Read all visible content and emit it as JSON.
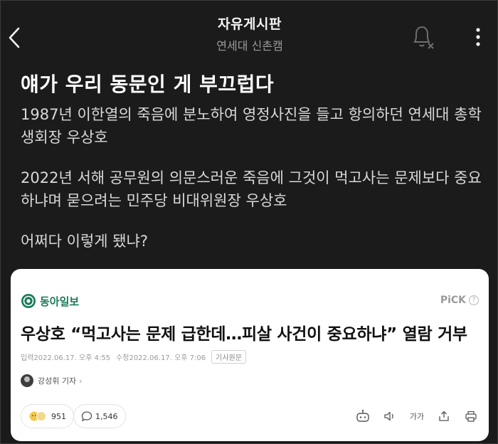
{
  "header": {
    "title": "자유게시판",
    "subtitle": "연세대 신촌캠"
  },
  "post": {
    "title": "얘가 우리 동문인 게 부끄럽다",
    "paragraphs": [
      "1987년 이한열의 죽음에 분노하여 영정사진을 들고 항의하던 연세대 총학생회장 우상호",
      "2022년 서해 공무원의 의문스러운 죽음에 그것이 먹고사는 문제보다 중요하냐며 묻으려는 민주당 비대위원장 우상호",
      "어쩌다 이렇게 됐냐?"
    ]
  },
  "article": {
    "publisher": "동아일보",
    "pick_label": "PiCK",
    "pick_help": "?",
    "headline": "우상호 “먹고사는 문제 급한데…피살 사건이 중요하냐” 열람 거부",
    "input_time": "입력2022.06.17. 오후 4:55",
    "edit_time": "수정2022.06.17. 오후 7:06",
    "original_label": "기사원문",
    "reporter": "강성휘 기자",
    "reporter_chevron": "›",
    "reaction_count": "951",
    "comment_count": "1,546",
    "fontsize_label": "가가"
  },
  "colors": {
    "background": "#1b1b1b",
    "publisher_green": "#1b7a5a",
    "card": "#ffffff"
  },
  "icons": [
    "back-arrow-icon",
    "bell-off-icon",
    "more-vertical-icon",
    "donga-logo-icon",
    "reaction-icon",
    "comment-icon",
    "summary-bot-icon",
    "audio-icon",
    "font-size-icon",
    "share-icon",
    "print-icon"
  ]
}
